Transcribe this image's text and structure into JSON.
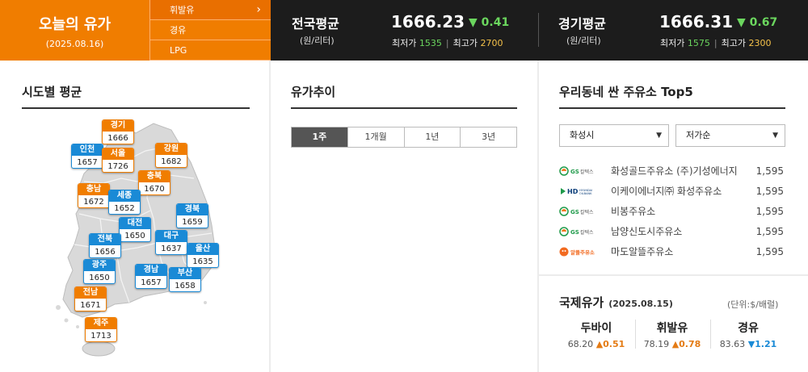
{
  "today": {
    "title": "오늘의 유가",
    "date": "(2025.08.16)"
  },
  "fuel_tabs": [
    {
      "label": "휘발유",
      "active": true
    },
    {
      "label": "경유",
      "active": false
    },
    {
      "label": "LPG",
      "active": false
    }
  ],
  "national": {
    "name": "전국평균",
    "unit": "(원/리터)",
    "price": "1666.23",
    "delta": "▼ 0.41",
    "min_label": "최저가",
    "min": "1535",
    "max_label": "최고가",
    "max": "2700"
  },
  "gyeonggi": {
    "name": "경기평균",
    "unit": "(원/리터)",
    "price": "1666.31",
    "delta": "▼ 0.67",
    "min_label": "최저가",
    "min": "1575",
    "max_label": "최고가",
    "max": "2300"
  },
  "regional": {
    "title": "시도별 평균",
    "regions": [
      {
        "name": "경기",
        "value": "1666",
        "color": "orange"
      },
      {
        "name": "인천",
        "value": "1657",
        "color": "blue"
      },
      {
        "name": "서울",
        "value": "1726",
        "color": "orange"
      },
      {
        "name": "강원",
        "value": "1682",
        "color": "orange"
      },
      {
        "name": "충북",
        "value": "1670",
        "color": "orange"
      },
      {
        "name": "충남",
        "value": "1672",
        "color": "orange"
      },
      {
        "name": "세종",
        "value": "1652",
        "color": "blue"
      },
      {
        "name": "경북",
        "value": "1659",
        "color": "blue"
      },
      {
        "name": "대전",
        "value": "1650",
        "color": "blue"
      },
      {
        "name": "전북",
        "value": "1656",
        "color": "blue"
      },
      {
        "name": "대구",
        "value": "1637",
        "color": "blue"
      },
      {
        "name": "울산",
        "value": "1635",
        "color": "blue"
      },
      {
        "name": "광주",
        "value": "1650",
        "color": "blue"
      },
      {
        "name": "경남",
        "value": "1657",
        "color": "blue"
      },
      {
        "name": "부산",
        "value": "1658",
        "color": "blue"
      },
      {
        "name": "전남",
        "value": "1671",
        "color": "orange"
      },
      {
        "name": "제주",
        "value": "1713",
        "color": "orange"
      }
    ]
  },
  "trend": {
    "title": "유가추이",
    "tabs": [
      {
        "label": "1주",
        "active": true
      },
      {
        "label": "1개월",
        "active": false
      },
      {
        "label": "1년",
        "active": false
      },
      {
        "label": "3년",
        "active": false
      }
    ]
  },
  "top5": {
    "title": "우리동네 싼 주유소 Top5",
    "region_select": "화성시",
    "sort_select": "저가순",
    "stations": [
      {
        "brand": "GS칼텍스",
        "name": "화성골드주유소 (주)기성에너지",
        "price": "1,595"
      },
      {
        "brand": "HD HYUNDAI OILBANK",
        "name": "이케이에너지㈜ 화성주유소",
        "price": "1,595"
      },
      {
        "brand": "GS칼텍스",
        "name": "비봉주유소",
        "price": "1,595"
      },
      {
        "brand": "GS칼텍스",
        "name": "남양신도시주유소",
        "price": "1,595"
      },
      {
        "brand": "알뜰주유소",
        "name": "마도알뜰주유소",
        "price": "1,595"
      }
    ]
  },
  "intl": {
    "title": "국제유가",
    "date": "(2025.08.15)",
    "unit": "(단위:$/배럴)",
    "items": [
      {
        "name": "두바이",
        "value": "68.20",
        "change": "▲0.51",
        "direction": "up"
      },
      {
        "name": "휘발유",
        "value": "78.19",
        "change": "▲0.78",
        "direction": "up"
      },
      {
        "name": "경유",
        "value": "83.63",
        "change": "▼1.21",
        "direction": "down"
      }
    ]
  },
  "colors": {
    "orange": "#f07d00",
    "blue": "#1a8ad6",
    "green_delta": "#6bd65e",
    "topbar": "#1c1c1c"
  }
}
